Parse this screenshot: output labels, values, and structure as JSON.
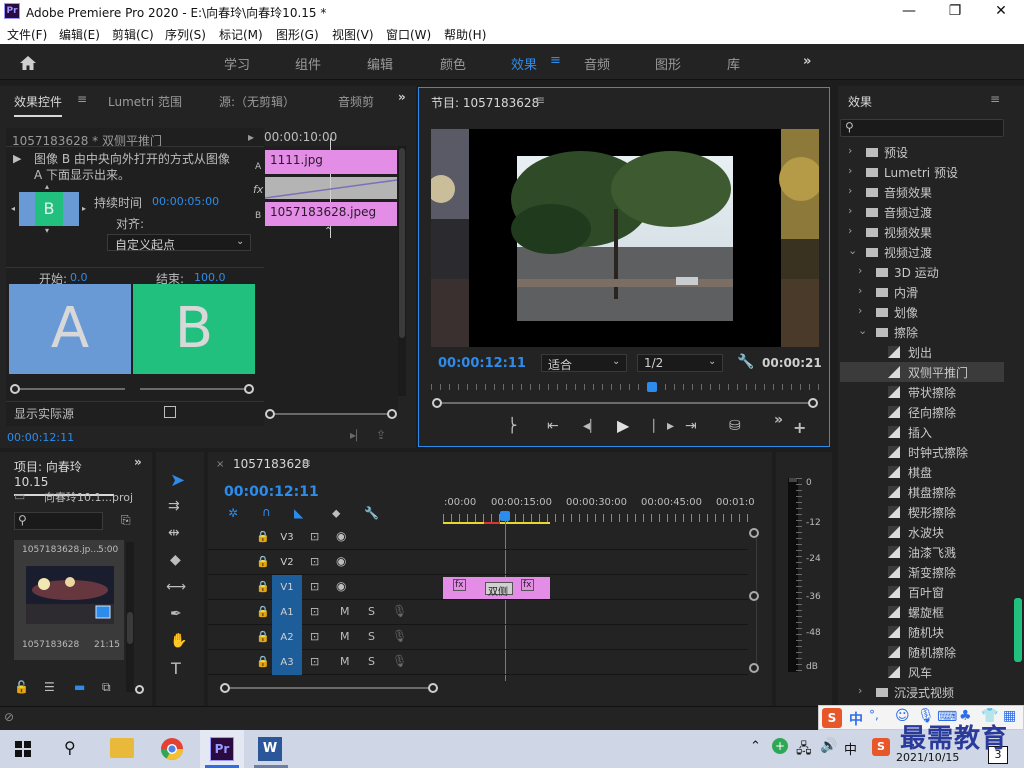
{
  "window": {
    "title": "Adobe Premiere Pro 2020 - E:\\向春玲\\向春玲10.15 *",
    "app_badge": "Pr",
    "minimize": "—",
    "maximize": "❐",
    "close": "✕"
  },
  "menu": [
    "文件(F)",
    "编辑(E)",
    "剪辑(C)",
    "序列(S)",
    "标记(M)",
    "图形(G)",
    "视图(V)",
    "窗口(W)",
    "帮助(H)"
  ],
  "workspaces": [
    "学习",
    "组件",
    "编辑",
    "颜色",
    "效果",
    "音频",
    "图形",
    "库"
  ],
  "active_workspace": "效果",
  "effect_controls": {
    "tabs": [
      "效果控件",
      "Lumetri 范围",
      "源:（无剪辑）",
      "音频剪"
    ],
    "clip_name": "1057183628 * 双侧平推门",
    "timecode_header": "00:00:10:00",
    "description": "图像 B 由中央向外打开的方式从图像 A 下面显示出来。",
    "duration_label": "持续时间",
    "duration_value": "00:00:05:00",
    "align_label": "对齐:",
    "align_value": "自定义起点",
    "start_label": "开始:",
    "start_value": "0.0",
    "end_label": "结束:",
    "end_value": "100.0",
    "preview_a": "A",
    "preview_b": "B",
    "thumb_b": "B",
    "show_actual": "显示实际源",
    "clip_a": "1111.jpg",
    "clip_b": "1057183628.jpeg",
    "track_a": "A",
    "track_b": "B",
    "fx_label": "fx",
    "footer_time": "00:00:12:11"
  },
  "program": {
    "title": "节目: 1057183628",
    "timecode": "00:00:12:11",
    "fit": "适合",
    "resolution": "1/2",
    "duration": "00:00:21"
  },
  "project": {
    "title": "项目: 向春玲10.15",
    "file": "向春玲10.1...proj",
    "clip_name": "1057183628.jp...",
    "clip_dur": "5:00",
    "clip2_name": "1057183628",
    "clip2_dur": "21:15"
  },
  "timeline": {
    "seq_name": "1057183628",
    "timecode": "00:00:12:11",
    "ruler": [
      ":00:00",
      "00:00:15:00",
      "00:00:30:00",
      "00:00:45:00",
      "00:01:0"
    ],
    "tracks": [
      {
        "name": "V3",
        "type": "video"
      },
      {
        "name": "V2",
        "type": "video"
      },
      {
        "name": "V1",
        "type": "video"
      },
      {
        "name": "A1",
        "type": "audio"
      },
      {
        "name": "A2",
        "type": "audio"
      },
      {
        "name": "A3",
        "type": "audio"
      }
    ],
    "transition_label": "双侧",
    "clip_fx": "fx",
    "audio_mute": "M",
    "audio_solo": "S"
  },
  "meter": {
    "labels": [
      "0",
      "-12",
      "-24",
      "-36",
      "-48",
      "dB"
    ]
  },
  "effects": {
    "title": "效果",
    "items": [
      {
        "label": "预设",
        "level": 0,
        "kind": "folder",
        "open": false
      },
      {
        "label": "Lumetri 预设",
        "level": 0,
        "kind": "folder",
        "open": false
      },
      {
        "label": "音频效果",
        "level": 0,
        "kind": "folder",
        "open": false
      },
      {
        "label": "音频过渡",
        "level": 0,
        "kind": "folder",
        "open": false
      },
      {
        "label": "视频效果",
        "level": 0,
        "kind": "folder",
        "open": false
      },
      {
        "label": "视频过渡",
        "level": 0,
        "kind": "folder",
        "open": true
      },
      {
        "label": "3D 运动",
        "level": 1,
        "kind": "folder",
        "open": false
      },
      {
        "label": "内滑",
        "level": 1,
        "kind": "folder",
        "open": false
      },
      {
        "label": "划像",
        "level": 1,
        "kind": "folder",
        "open": false
      },
      {
        "label": "擦除",
        "level": 1,
        "kind": "folder",
        "open": true
      },
      {
        "label": "划出",
        "level": 2,
        "kind": "fx",
        "open": false
      },
      {
        "label": "双侧平推门",
        "level": 2,
        "kind": "fx",
        "open": false,
        "selected": true
      },
      {
        "label": "带状擦除",
        "level": 2,
        "kind": "fx",
        "open": false
      },
      {
        "label": "径向擦除",
        "level": 2,
        "kind": "fx",
        "open": false
      },
      {
        "label": "插入",
        "level": 2,
        "kind": "fx",
        "open": false
      },
      {
        "label": "时钟式擦除",
        "level": 2,
        "kind": "fx",
        "open": false
      },
      {
        "label": "棋盘",
        "level": 2,
        "kind": "fx",
        "open": false
      },
      {
        "label": "棋盘擦除",
        "level": 2,
        "kind": "fx",
        "open": false
      },
      {
        "label": "楔形擦除",
        "level": 2,
        "kind": "fx",
        "open": false
      },
      {
        "label": "水波块",
        "level": 2,
        "kind": "fx",
        "open": false
      },
      {
        "label": "油漆飞溅",
        "level": 2,
        "kind": "fx",
        "open": false
      },
      {
        "label": "渐变擦除",
        "level": 2,
        "kind": "fx",
        "open": false
      },
      {
        "label": "百叶窗",
        "level": 2,
        "kind": "fx",
        "open": false
      },
      {
        "label": "螺旋框",
        "level": 2,
        "kind": "fx",
        "open": false
      },
      {
        "label": "随机块",
        "level": 2,
        "kind": "fx",
        "open": false
      },
      {
        "label": "随机擦除",
        "level": 2,
        "kind": "fx",
        "open": false
      },
      {
        "label": "风车",
        "level": 2,
        "kind": "fx",
        "open": false
      },
      {
        "label": "沉浸式视频",
        "level": 1,
        "kind": "folder",
        "open": false
      }
    ]
  },
  "ime": {
    "s_logo": "S",
    "lang": "中",
    "punct": "°,"
  },
  "watermark": "最需教育",
  "taskbar": {
    "date": "2021/10/15",
    "ime": "中",
    "word": "W",
    "pr": "Pr",
    "notif": "3"
  },
  "colors": {
    "accent": "#2d8ceb",
    "clip_pink": "#e38de6",
    "preview_a": "#6a9ad6",
    "preview_b": "#22c07e",
    "track_blue": "#1d5d9a"
  }
}
